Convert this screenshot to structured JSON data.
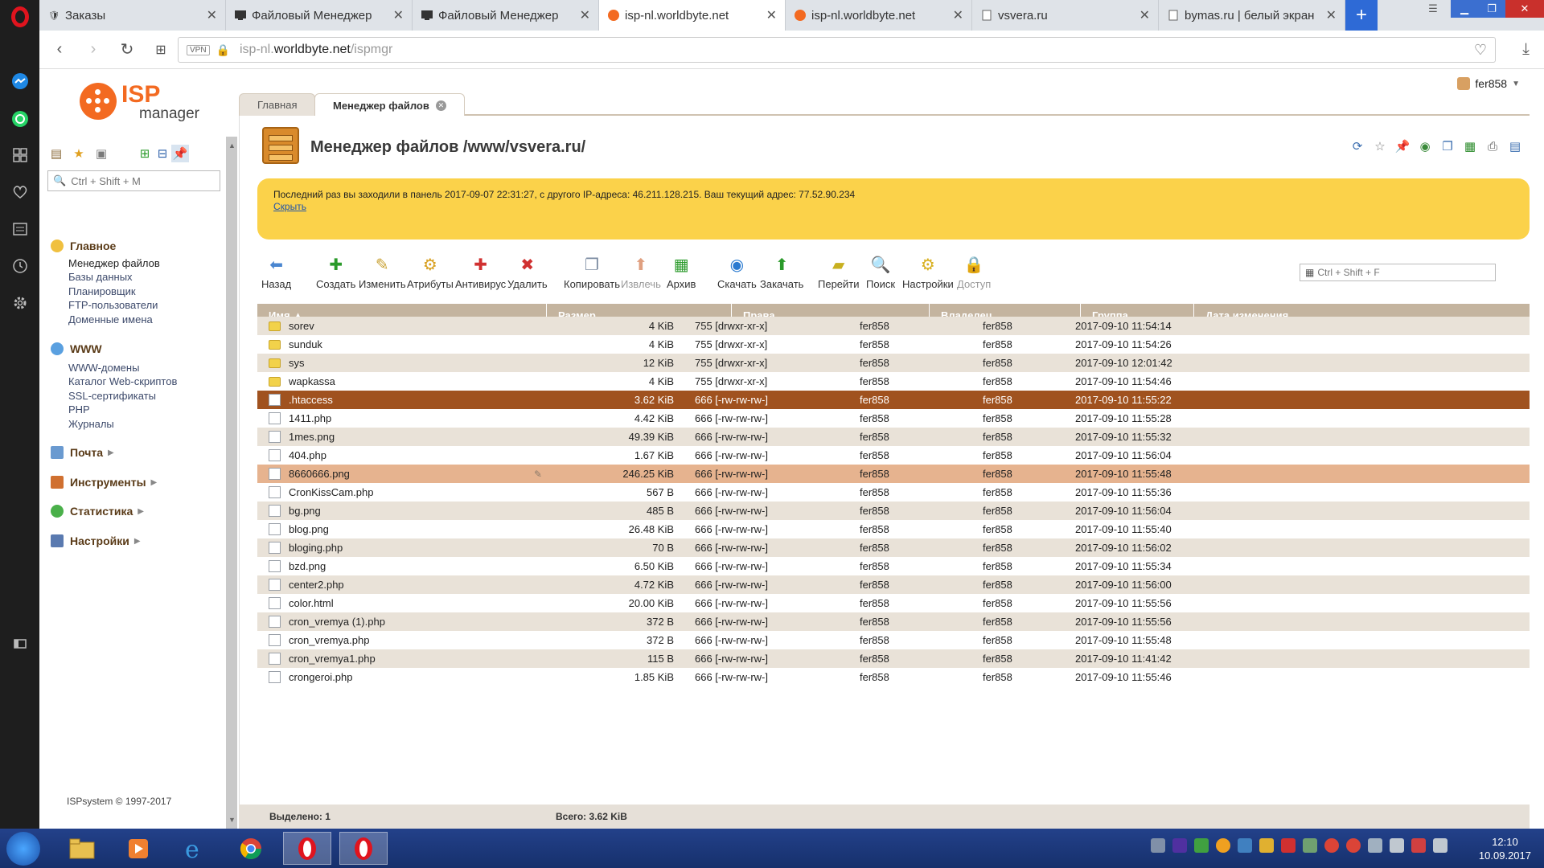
{
  "browser": {
    "tabs": [
      {
        "label": "Заказы",
        "active": false
      },
      {
        "label": "Файловый Менеджер",
        "active": false
      },
      {
        "label": "Файловый Менеджер",
        "active": false
      },
      {
        "label": "isp-nl.worldbyte.net",
        "active": true
      },
      {
        "label": "isp-nl.worldbyte.net",
        "active": false
      },
      {
        "label": "vsvera.ru",
        "active": false
      },
      {
        "label": "bymas.ru | белый экран",
        "active": false
      }
    ],
    "url_vpn": "VPN",
    "url_prefix": "isp-nl.",
    "url_domain": "worldbyte.net",
    "url_path": "/ispmgr"
  },
  "logo": {
    "isp": "ISP",
    "manager": "manager"
  },
  "user": {
    "name": "fer858"
  },
  "sidebar": {
    "search_placeholder": "Ctrl + Shift + M",
    "sections": [
      {
        "label": "Главное",
        "items": [
          "Менеджер файлов",
          "Базы данных",
          "Планировщик",
          "FTP-пользователи",
          "Доменные имена"
        ]
      },
      {
        "label": "WWW",
        "items": [
          "WWW-домены",
          "Каталог Web-скриптов",
          "SSL-сертификаты",
          "PHP",
          "Журналы"
        ]
      },
      {
        "label": "Почта",
        "items": []
      },
      {
        "label": "Инструменты",
        "items": []
      },
      {
        "label": "Статистика",
        "items": []
      },
      {
        "label": "Настройки",
        "items": []
      }
    ],
    "footer": "ISPsystem © 1997-2017"
  },
  "page_tabs": [
    "Главная",
    "Менеджер файлов"
  ],
  "title": "Менеджер файлов /www/vsvera.ru/",
  "notice": {
    "text": "Последний раз вы заходили в панель 2017-09-07 22:31:27, с другого IP-адреса: 46.211.128.215. Ваш текущий адрес: 77.52.90.234",
    "link": "Скрыть"
  },
  "toolbar": {
    "buttons": [
      "Назад",
      "Создать",
      "Изменить",
      "Атрибуты",
      "Антивирус",
      "Удалить",
      "Копировать",
      "Извлечь",
      "Архив",
      "Скачать",
      "Закачать",
      "Перейти",
      "Поиск",
      "Настройки",
      "Доступ"
    ],
    "search_placeholder": "Ctrl + Shift + F"
  },
  "table": {
    "columns": [
      "Имя ▲",
      "Размер",
      "Права",
      "Владелец",
      "Группа",
      "Дата изменения"
    ],
    "rows": [
      {
        "name": "sorev",
        "type": "folder",
        "size": "4 KiB",
        "perm": "755 [drwxr-xr-x]",
        "owner": "fer858",
        "group": "fer858",
        "date": "2017-09-10 11:54:14",
        "state": "partial"
      },
      {
        "name": "sunduk",
        "type": "folder",
        "size": "4 KiB",
        "perm": "755 [drwxr-xr-x]",
        "owner": "fer858",
        "group": "fer858",
        "date": "2017-09-10 11:54:26",
        "state": ""
      },
      {
        "name": "sys",
        "type": "folder",
        "size": "12 KiB",
        "perm": "755 [drwxr-xr-x]",
        "owner": "fer858",
        "group": "fer858",
        "date": "2017-09-10 12:01:42",
        "state": ""
      },
      {
        "name": "wapkassa",
        "type": "folder",
        "size": "4 KiB",
        "perm": "755 [drwxr-xr-x]",
        "owner": "fer858",
        "group": "fer858",
        "date": "2017-09-10 11:54:46",
        "state": ""
      },
      {
        "name": ".htaccess",
        "type": "file",
        "size": "3.62 KiB",
        "perm": "666 [-rw-rw-rw-]",
        "owner": "fer858",
        "group": "fer858",
        "date": "2017-09-10 11:55:22",
        "state": "selected"
      },
      {
        "name": "1411.php",
        "type": "file",
        "size": "4.42 KiB",
        "perm": "666 [-rw-rw-rw-]",
        "owner": "fer858",
        "group": "fer858",
        "date": "2017-09-10 11:55:28",
        "state": ""
      },
      {
        "name": "1mes.png",
        "type": "file",
        "size": "49.39 KiB",
        "perm": "666 [-rw-rw-rw-]",
        "owner": "fer858",
        "group": "fer858",
        "date": "2017-09-10 11:55:32",
        "state": ""
      },
      {
        "name": "404.php",
        "type": "file",
        "size": "1.67 KiB",
        "perm": "666 [-rw-rw-rw-]",
        "owner": "fer858",
        "group": "fer858",
        "date": "2017-09-10 11:56:04",
        "state": ""
      },
      {
        "name": "8660666.png",
        "type": "file",
        "size": "246.25 KiB",
        "perm": "666 [-rw-rw-rw-]",
        "owner": "fer858",
        "group": "fer858",
        "date": "2017-09-10 11:55:48",
        "state": "hover"
      },
      {
        "name": "CronKissCam.php",
        "type": "file",
        "size": "567 B",
        "perm": "666 [-rw-rw-rw-]",
        "owner": "fer858",
        "group": "fer858",
        "date": "2017-09-10 11:55:36",
        "state": ""
      },
      {
        "name": "bg.png",
        "type": "file",
        "size": "485 B",
        "perm": "666 [-rw-rw-rw-]",
        "owner": "fer858",
        "group": "fer858",
        "date": "2017-09-10 11:56:04",
        "state": ""
      },
      {
        "name": "blog.png",
        "type": "file",
        "size": "26.48 KiB",
        "perm": "666 [-rw-rw-rw-]",
        "owner": "fer858",
        "group": "fer858",
        "date": "2017-09-10 11:55:40",
        "state": ""
      },
      {
        "name": "bloging.php",
        "type": "file",
        "size": "70 B",
        "perm": "666 [-rw-rw-rw-]",
        "owner": "fer858",
        "group": "fer858",
        "date": "2017-09-10 11:56:02",
        "state": ""
      },
      {
        "name": "bzd.png",
        "type": "file",
        "size": "6.50 KiB",
        "perm": "666 [-rw-rw-rw-]",
        "owner": "fer858",
        "group": "fer858",
        "date": "2017-09-10 11:55:34",
        "state": ""
      },
      {
        "name": "center2.php",
        "type": "file",
        "size": "4.72 KiB",
        "perm": "666 [-rw-rw-rw-]",
        "owner": "fer858",
        "group": "fer858",
        "date": "2017-09-10 11:56:00",
        "state": ""
      },
      {
        "name": "color.html",
        "type": "file",
        "size": "20.00 KiB",
        "perm": "666 [-rw-rw-rw-]",
        "owner": "fer858",
        "group": "fer858",
        "date": "2017-09-10 11:55:56",
        "state": ""
      },
      {
        "name": "cron_vremya (1).php",
        "type": "file",
        "size": "372 B",
        "perm": "666 [-rw-rw-rw-]",
        "owner": "fer858",
        "group": "fer858",
        "date": "2017-09-10 11:55:56",
        "state": ""
      },
      {
        "name": "cron_vremya.php",
        "type": "file",
        "size": "372 B",
        "perm": "666 [-rw-rw-rw-]",
        "owner": "fer858",
        "group": "fer858",
        "date": "2017-09-10 11:55:48",
        "state": ""
      },
      {
        "name": "cron_vremya1.php",
        "type": "file",
        "size": "115 B",
        "perm": "666 [-rw-rw-rw-]",
        "owner": "fer858",
        "group": "fer858",
        "date": "2017-09-10 11:41:42",
        "state": ""
      },
      {
        "name": "crongeroi.php",
        "type": "file",
        "size": "1.85 KiB",
        "perm": "666 [-rw-rw-rw-]",
        "owner": "fer858",
        "group": "fer858",
        "date": "2017-09-10 11:55:46",
        "state": ""
      }
    ]
  },
  "status": {
    "selected": "Выделено: 1",
    "total": "Всего: 3.62 KiB"
  },
  "clock": {
    "time": "12:10",
    "date": "10.09.2017"
  },
  "colors": {
    "accent": "#f36a21",
    "notice": "#fbd24a",
    "selected_row": "#a0521f",
    "header": "#c4b49f"
  }
}
